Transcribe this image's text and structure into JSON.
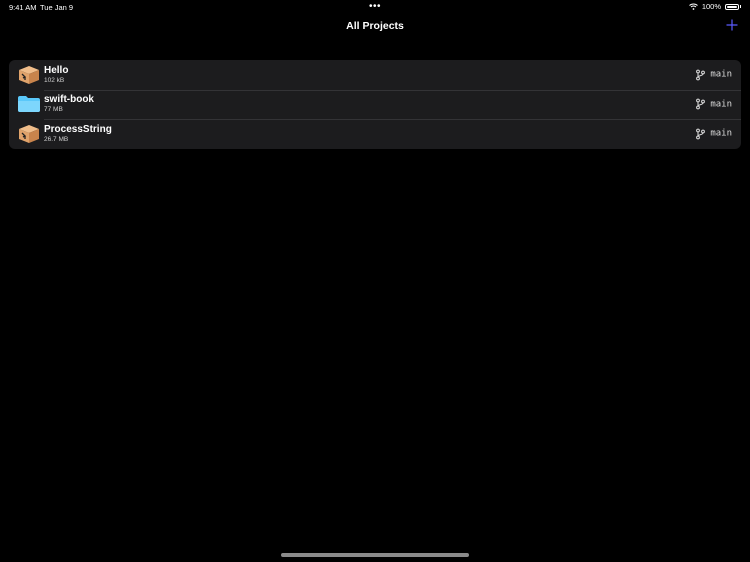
{
  "status_bar": {
    "time": "9:41 AM",
    "date": "Tue Jan 9",
    "battery": "100%"
  },
  "nav": {
    "title": "All Projects"
  },
  "projects": [
    {
      "name": "Hello",
      "size": "102 kB",
      "branch": "main",
      "icon": "package-icon"
    },
    {
      "name": "swift-book",
      "size": "77 MB",
      "branch": "main",
      "icon": "folder-icon"
    },
    {
      "name": "ProcessString",
      "size": "26.7 MB",
      "branch": "main",
      "icon": "package-icon"
    }
  ],
  "colors": {
    "background": "#000000",
    "list_background": "#1c1c1e",
    "accent": "#5b5bff",
    "folder": "#5ac8fa",
    "package": "#e0a36b"
  }
}
